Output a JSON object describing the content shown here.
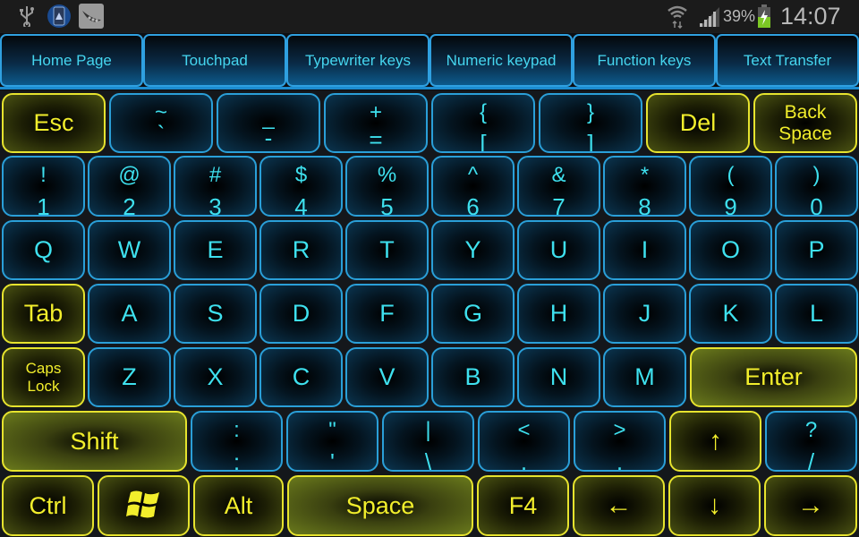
{
  "status_bar": {
    "left_icons": [
      "usb-icon",
      "app-shield-icon",
      "peapod-app-icon"
    ],
    "right_icons": [
      "wifi-icon",
      "signal-icon",
      "battery-charging-icon"
    ],
    "battery_percent": "39%",
    "time": "14:07",
    "colors": {
      "battery_fill": "#7cc824",
      "text": "#b8b8b8"
    }
  },
  "tabs": [
    {
      "label": "Home Page"
    },
    {
      "label": "Touchpad"
    },
    {
      "label": "Typewriter keys"
    },
    {
      "label": "Numeric keypad"
    },
    {
      "label": "Function keys"
    },
    {
      "label": "Text Transfer"
    }
  ],
  "keyboard": {
    "colors": {
      "blue_key_text": "#3ee0ee",
      "blue_key_border": "#2a9fd8",
      "yellow_key_text": "#f2ee2c",
      "yellow_key_border": "#e6e32e"
    },
    "rows": [
      [
        {
          "id": "esc",
          "label": "Esc",
          "style": "yellow"
        },
        {
          "id": "tilde",
          "top": "~",
          "bottom": "`",
          "style": "blue"
        },
        {
          "id": "minus",
          "top": "_",
          "bottom": "-",
          "style": "blue"
        },
        {
          "id": "equals",
          "top": "+",
          "bottom": "=",
          "style": "blue"
        },
        {
          "id": "lbracket",
          "top": "{",
          "bottom": "[",
          "style": "blue"
        },
        {
          "id": "rbracket",
          "top": "}",
          "bottom": "]",
          "style": "blue"
        },
        {
          "id": "del",
          "label": "Del",
          "style": "yellow"
        },
        {
          "id": "backspace",
          "label": "Back\nSpace",
          "line1": "Back",
          "line2": "Space",
          "style": "yellow"
        }
      ],
      [
        {
          "id": "1",
          "top": "!",
          "bottom": "1"
        },
        {
          "id": "2",
          "top": "@",
          "bottom": "2"
        },
        {
          "id": "3",
          "top": "#",
          "bottom": "3"
        },
        {
          "id": "4",
          "top": "$",
          "bottom": "4"
        },
        {
          "id": "5",
          "top": "%",
          "bottom": "5"
        },
        {
          "id": "6",
          "top": "^",
          "bottom": "6"
        },
        {
          "id": "7",
          "top": "&",
          "bottom": "7"
        },
        {
          "id": "8",
          "top": "*",
          "bottom": "8"
        },
        {
          "id": "9",
          "top": "(",
          "bottom": "9"
        },
        {
          "id": "0",
          "top": ")",
          "bottom": "0"
        }
      ],
      [
        {
          "label": "Q"
        },
        {
          "label": "W"
        },
        {
          "label": "E"
        },
        {
          "label": "R"
        },
        {
          "label": "T"
        },
        {
          "label": "Y"
        },
        {
          "label": "U"
        },
        {
          "label": "I"
        },
        {
          "label": "O"
        },
        {
          "label": "P"
        }
      ],
      [
        {
          "label": "Tab",
          "style": "yellow"
        },
        {
          "label": "A"
        },
        {
          "label": "S"
        },
        {
          "label": "D"
        },
        {
          "label": "F"
        },
        {
          "label": "G"
        },
        {
          "label": "H"
        },
        {
          "label": "J"
        },
        {
          "label": "K"
        },
        {
          "label": "L"
        }
      ],
      [
        {
          "line1": "Caps",
          "line2": "Lock",
          "style": "yellow"
        },
        {
          "label": "Z"
        },
        {
          "label": "X"
        },
        {
          "label": "C"
        },
        {
          "label": "V"
        },
        {
          "label": "B"
        },
        {
          "label": "N"
        },
        {
          "label": "M"
        },
        {
          "label": "Enter",
          "style": "yellow"
        }
      ],
      [
        {
          "label": "Shift",
          "style": "yellow"
        },
        {
          "top": ":",
          "bottom": ";"
        },
        {
          "top": "\"",
          "bottom": "'"
        },
        {
          "top": "|",
          "bottom": "\\"
        },
        {
          "top": "<",
          "bottom": ","
        },
        {
          "top": ">",
          "bottom": "."
        },
        {
          "label": "↑",
          "style": "yellow",
          "icon": "arrow-up-icon"
        },
        {
          "top": "?",
          "bottom": "/"
        }
      ],
      [
        {
          "label": "Ctrl",
          "style": "yellow"
        },
        {
          "label": "",
          "style": "yellow",
          "icon": "windows-logo-icon"
        },
        {
          "label": "Alt",
          "style": "yellow"
        },
        {
          "label": "Space",
          "style": "yellow"
        },
        {
          "label": "F4",
          "style": "yellow"
        },
        {
          "label": "←",
          "style": "yellow",
          "icon": "arrow-left-icon"
        },
        {
          "label": "↓",
          "style": "yellow",
          "icon": "arrow-down-icon"
        },
        {
          "label": "→",
          "style": "yellow",
          "icon": "arrow-right-icon"
        }
      ]
    ]
  }
}
